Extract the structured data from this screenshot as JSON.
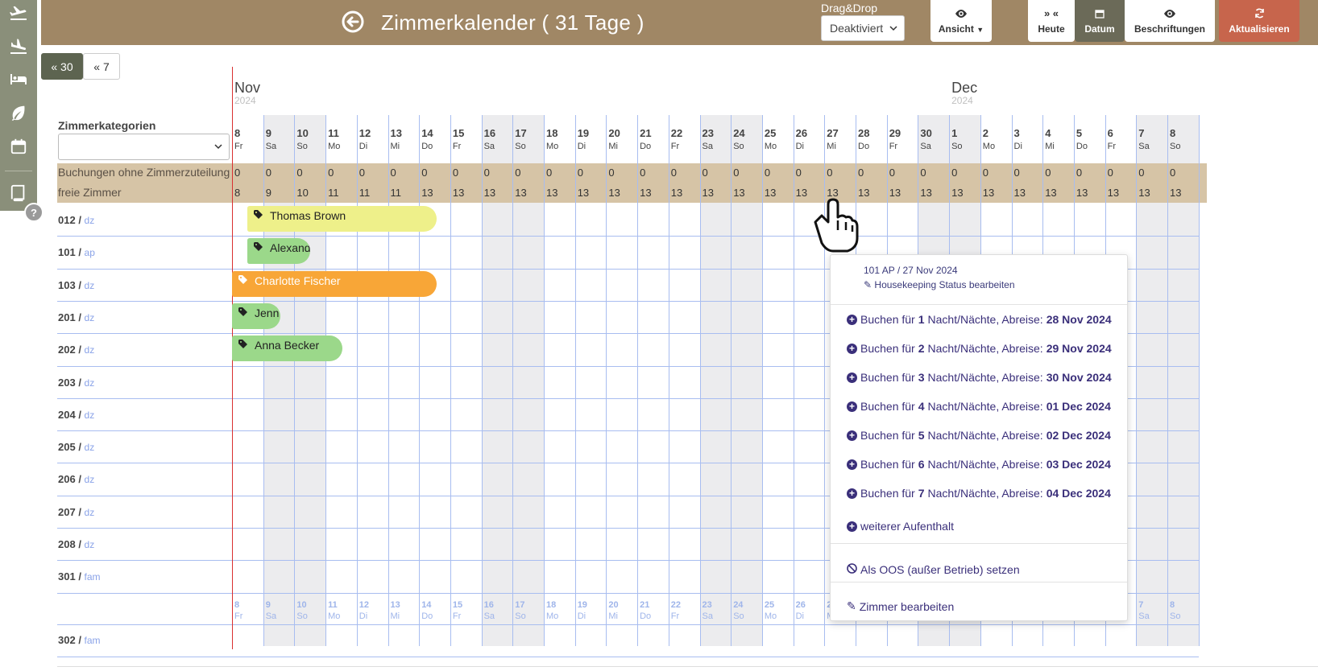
{
  "sidebar": {
    "icons": [
      "plane-departure-icon",
      "plane-arrival-icon",
      "bed-icon",
      "leaf-icon",
      "calendar-icon",
      "book-icon"
    ],
    "help_label": "?"
  },
  "header": {
    "title": "Zimmerkalender ( 31 Tage )",
    "dragdrop_label": "Drag&Drop",
    "dragdrop_value": "Deaktiviert",
    "buttons": {
      "ansicht": "Ansicht",
      "heute_icon": "» «",
      "heute": "Heute",
      "datum": "Datum",
      "beschriftungen": "Beschriftungen",
      "aktualisieren": "Aktualisieren"
    }
  },
  "nav": {
    "back30": "« 30",
    "back7": "« 7"
  },
  "calendar": {
    "months": [
      {
        "name": "Nov",
        "year": "2024"
      },
      {
        "name": "Dec",
        "year": "2024"
      }
    ],
    "category_label": "Zimmerkategorien",
    "category_value": "",
    "days": [
      {
        "d": "8",
        "w": "Fr"
      },
      {
        "d": "9",
        "w": "Sa"
      },
      {
        "d": "10",
        "w": "So"
      },
      {
        "d": "11",
        "w": "Mo"
      },
      {
        "d": "12",
        "w": "Di"
      },
      {
        "d": "13",
        "w": "Mi"
      },
      {
        "d": "14",
        "w": "Do"
      },
      {
        "d": "15",
        "w": "Fr"
      },
      {
        "d": "16",
        "w": "Sa"
      },
      {
        "d": "17",
        "w": "So"
      },
      {
        "d": "18",
        "w": "Mo"
      },
      {
        "d": "19",
        "w": "Di"
      },
      {
        "d": "20",
        "w": "Mi"
      },
      {
        "d": "21",
        "w": "Do"
      },
      {
        "d": "22",
        "w": "Fr"
      },
      {
        "d": "23",
        "w": "Sa"
      },
      {
        "d": "24",
        "w": "So"
      },
      {
        "d": "25",
        "w": "Mo"
      },
      {
        "d": "26",
        "w": "Di"
      },
      {
        "d": "27",
        "w": "Mi"
      },
      {
        "d": "28",
        "w": "Do"
      },
      {
        "d": "29",
        "w": "Fr"
      },
      {
        "d": "30",
        "w": "Sa"
      },
      {
        "d": "1",
        "w": "So"
      },
      {
        "d": "2",
        "w": "Mo"
      },
      {
        "d": "3",
        "w": "Di"
      },
      {
        "d": "4",
        "w": "Mi"
      },
      {
        "d": "5",
        "w": "Do"
      },
      {
        "d": "6",
        "w": "Fr"
      },
      {
        "d": "7",
        "w": "Sa"
      },
      {
        "d": "8",
        "w": "So"
      }
    ],
    "unassigned_label": "Buchungen ohne Zimmerzuteilung",
    "unassigned_values": [
      "0",
      "0",
      "0",
      "0",
      "0",
      "0",
      "0",
      "0",
      "0",
      "0",
      "0",
      "0",
      "0",
      "0",
      "0",
      "0",
      "0",
      "0",
      "0",
      "0",
      "0",
      "0",
      "0",
      "0",
      "0",
      "0",
      "0",
      "0",
      "0",
      "0",
      "0"
    ],
    "free_label": "freie Zimmer",
    "free_values": [
      "8",
      "9",
      "10",
      "11",
      "11",
      "11",
      "13",
      "13",
      "13",
      "13",
      "13",
      "13",
      "13",
      "13",
      "13",
      "13",
      "13",
      "13",
      "13",
      "13",
      "13",
      "13",
      "13",
      "13",
      "13",
      "13",
      "13",
      "13",
      "13",
      "13",
      "13"
    ],
    "rooms": [
      {
        "num": "012",
        "type": "dz"
      },
      {
        "num": "101",
        "type": "ap"
      },
      {
        "num": "103",
        "type": "dz"
      },
      {
        "num": "201",
        "type": "dz"
      },
      {
        "num": "202",
        "type": "dz"
      },
      {
        "num": "203",
        "type": "dz"
      },
      {
        "num": "204",
        "type": "dz"
      },
      {
        "num": "205",
        "type": "dz"
      },
      {
        "num": "206",
        "type": "dz"
      },
      {
        "num": "207",
        "type": "dz"
      },
      {
        "num": "208",
        "type": "dz"
      },
      {
        "num": "301",
        "type": "fam"
      },
      {
        "num": "302",
        "type": "fam"
      }
    ],
    "bookings": [
      {
        "name": "Thomas Brown",
        "room": "012",
        "color": "#eef08a"
      },
      {
        "name": "Alexand",
        "room": "101",
        "color": "#9bd88a"
      },
      {
        "name": "Charlotte Fischer",
        "room": "103",
        "color": "#f8a637"
      },
      {
        "name": "Jenn",
        "room": "201",
        "color": "#9bd88a"
      },
      {
        "name": "Anna Becker",
        "room": "202",
        "color": "#9bd88a"
      }
    ]
  },
  "context_menu": {
    "title": "101 AP / 27 Nov 2024",
    "housekeeping": "Housekeeping Status bearbeiten",
    "book_prefix": "Buchen für",
    "book_mid": "Nacht/Nächte, Abreise:",
    "book_options": [
      {
        "n": "1",
        "date": "28 Nov 2024"
      },
      {
        "n": "2",
        "date": "29 Nov 2024"
      },
      {
        "n": "3",
        "date": "30 Nov 2024"
      },
      {
        "n": "4",
        "date": "01 Dec 2024"
      },
      {
        "n": "5",
        "date": "02 Dec 2024"
      },
      {
        "n": "6",
        "date": "03 Dec 2024"
      },
      {
        "n": "7",
        "date": "04 Dec 2024"
      }
    ],
    "more_stay": "weiterer Aufenthalt",
    "set_oos": "Als OOS (außer Betrieb) setzen",
    "edit_room": "Zimmer bearbeiten"
  },
  "colors": {
    "header_bg": "#a08765",
    "sidebar_bg": "#8a8f7a",
    "band_bg": "#d6c4a6",
    "refresh_bg": "#c7654c",
    "datum_bg": "#6b6a58",
    "grid_line": "#a8bdf0",
    "today_line": "#d93030"
  }
}
